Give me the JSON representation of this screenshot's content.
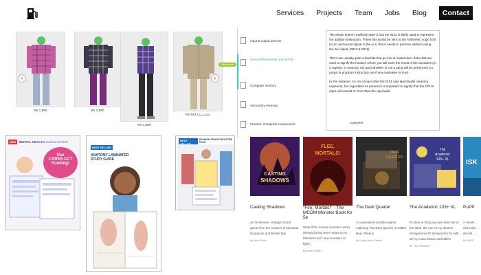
{
  "header": {
    "nav": [
      {
        "label": "Services"
      },
      {
        "label": "Projects"
      },
      {
        "label": "Team"
      },
      {
        "label": "Jobs"
      },
      {
        "label": "Blog"
      },
      {
        "label": "Contact"
      }
    ]
  },
  "products": {
    "items": [
      {
        "price": "Rs 1,550",
        "shirt": "#c060a0"
      },
      {
        "price": "Rs 1,550",
        "shirt": "#3a3a4a"
      },
      {
        "price": "Rs 1,550",
        "shirt": "#55408a"
      },
      {
        "price": "Rs 933",
        "sale": "Rs 1,550",
        "shirt": "#b9a88a"
      }
    ]
  },
  "cpu": {
    "items": [
      {
        "label": "Input & output devices"
      },
      {
        "label": "Central Processing Unit (CPU)"
      },
      {
        "label": "Computer memory"
      },
      {
        "label": "Secondary memory"
      },
      {
        "label": "Practice: Computer components"
      }
    ],
    "pill": "View more"
  },
  "article": {
    "p1": "The article doesn't explicitly state it, but the 0101 is likely used to represent the addition instruction. These bits would be sent to the Arithmetic Logic Unit (ALU) and would signal to the ALU that it needs to perform addition using the two inputs (0010 & 0011).",
    "p2": "There are usually quite a few bits that go into an instruction. Extra bits are used to signify the location where you will store the result of the operation (in a register, in memory, etc) and whether or not a jump will be performed (i.e. jumps to program instruction are if you evaluates to true).",
    "p3": "In this instance, I'm not certain what the 0101 was specifically meant to represent, but regardless its presence is important to signify that the CPU's input will consist of more than the operands.",
    "comment": "Comment"
  },
  "guides": {
    "mental": {
      "badge": "NEW",
      "title": "MENTAL HEALTH",
      "sub": "SIGNS & SUPPORT",
      "use": "Use",
      "cares": "CARES ACT",
      "funding": "Funding!"
    },
    "anatomy": {
      "badge": "BEST SELLER",
      "title": "ANATOMY LAMINATED STUDY GUIDE"
    },
    "spanish": {
      "badge": "BEST SELLER",
      "title": "SPANISH GRADE BOOSTER PACK"
    }
  },
  "games": [
    {
      "title": "Casting Shadows",
      "desc": "An immersive, strategic board game from the creators of Dinosaur Dungeons and Beetle Bay",
      "by": "By Hero Robe",
      "cover": "#3a1a5a",
      "accent": "#ff7a20",
      "cover_text": "CASTING SHADOWS"
    },
    {
      "title": "\"Fire, Mortals!\" - The MCDM Monster Book for 5e",
      "desc": "What if the normal monsters we're already facing were meant to be ... Monsters too? and monsters to fight?",
      "by": "By Matt Colville",
      "cover": "#7a1a1a",
      "accent": "#f0a020",
      "cover_text": "FLEE, MORTALS!"
    },
    {
      "title": "The Dark Quarter",
      "desc": "A cooperative narrative game exploring The Dark Quarter of 1980s New Orleans",
      "by": "By Lucky Duck Games",
      "cover": "#2a2a2a",
      "accent": "#d0a040",
      "cover_text": "THE DARK QUARTER"
    },
    {
      "title": "The Academic 103+ XL",
      "desc": "It's time to bring my own desk fan to the table, the one of my dreams. Designed so it'll designed to be with all my music bases and tables.",
      "by": "By The Professor",
      "cover": "#3a3a8a",
      "accent": "#f0d060",
      "cover_text": "The Academic 103+ XL"
    },
    {
      "title": "PuPP",
      "desc": "A 'whole ... and colla ... decide ...",
      "by": "By PuPP",
      "cover": "#2a8ac0",
      "accent": "#ffffff",
      "cover_text": "ISK"
    }
  ]
}
